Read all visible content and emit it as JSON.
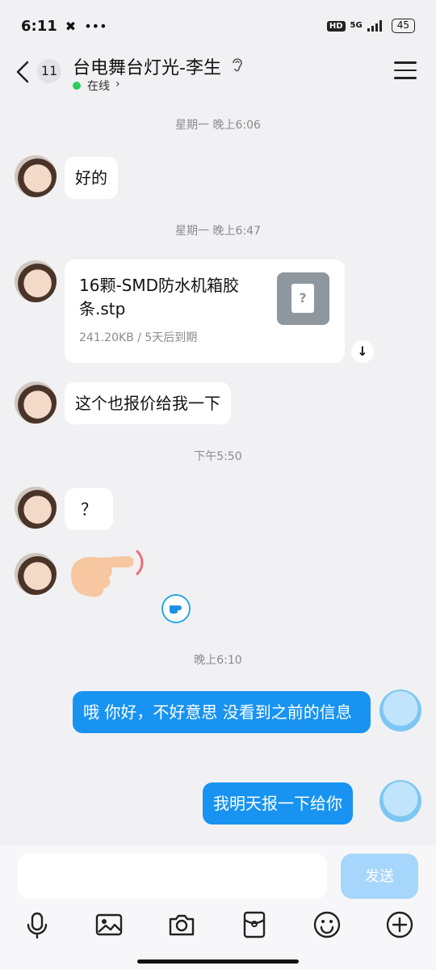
{
  "status_bar": {
    "time": "6:11",
    "hd": "HD",
    "network": "5G",
    "battery": "45"
  },
  "header": {
    "unread_count": "11",
    "title": "台电舞台灯光-李生",
    "status": "在线",
    "status_chevron": "›"
  },
  "messages": {
    "ts1": "星期一 晚上6:06",
    "m1": "好的",
    "ts2": "星期一 晚上6:47",
    "file": {
      "name": "16颗-SMD防水机箱胶条.stp",
      "meta": "241.20KB / 5天后到期",
      "icon_glyph": "?"
    },
    "m2": "这个也报价给我一下",
    "ts3": "下午5:50",
    "m3": "？",
    "ts4": "晚上6:10",
    "m4": "哦 你好，不好意思 没看到之前的信息",
    "m5": "我明天报一下给你"
  },
  "input": {
    "placeholder": "",
    "send_label": "发送"
  },
  "toolbar_icons": [
    "mic-icon",
    "image-icon",
    "camera-icon",
    "red-packet-icon",
    "emoji-icon",
    "plus-icon"
  ],
  "colors": {
    "accent": "#1893f1",
    "send_disabled": "#a6d6fb",
    "online": "#2ecc5b",
    "background": "#f1f1f3"
  }
}
